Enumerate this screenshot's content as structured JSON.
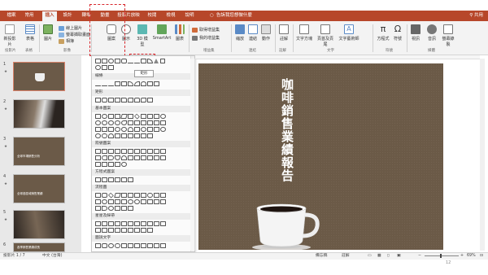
{
  "tabs": [
    {
      "label": "檔案",
      "active": false
    },
    {
      "label": "常用",
      "active": false
    },
    {
      "label": "插入",
      "active": true
    },
    {
      "label": "設計",
      "active": false
    },
    {
      "label": "轉場",
      "active": false
    },
    {
      "label": "動畫",
      "active": false
    },
    {
      "label": "投影片放映",
      "active": false
    },
    {
      "label": "校閱",
      "active": false
    },
    {
      "label": "檢視",
      "active": false
    },
    {
      "label": "說明",
      "active": false
    }
  ],
  "tell_me": "告訴我您想做什麼",
  "share": "共用",
  "ribbon": {
    "new_slide": "新投影片",
    "table": "表格",
    "images": "圖片",
    "online_images": "線上圖片",
    "screenshot": "螢幕擷取畫面",
    "album": "相簿",
    "shapes": "圖案",
    "icons": "圖示",
    "models_3d": "3D 模型",
    "smartart": "SmartArt",
    "chart": "圖表",
    "get_addins": "取得增益集",
    "my_addins": "我的增益集",
    "zoom": "縮放",
    "link": "連結",
    "action": "動作",
    "comment": "註解",
    "textbox": "文字方塊",
    "header_footer": "頁首及頁尾",
    "wordart": "文字藝術師",
    "equation": "方程式",
    "symbol": "符號",
    "video": "視訊",
    "audio": "音訊",
    "screen_recording": "螢幕錄製",
    "groups": {
      "slides": "投影片",
      "tables": "表格",
      "images": "影像",
      "addins": "增益集",
      "links": "連結",
      "comments": "註解",
      "text": "文字",
      "symbols": "符號",
      "media": "媒體"
    }
  },
  "gallery": {
    "sections": [
      "線條",
      "矩形",
      "基本圖案",
      "箭號圖案",
      "方程式圖案",
      "流程圖",
      "星星及綵帶",
      "圖說文字"
    ],
    "tooltip": "矩形"
  },
  "slides": [
    {
      "num": "1",
      "title": "咖啡銷售業績報告",
      "selected": true
    },
    {
      "num": "2",
      "title": "",
      "selected": false
    },
    {
      "num": "3",
      "title": "全球市場銷售分析",
      "selected": false
    },
    {
      "num": "4",
      "title": "全球各區域銷售業績",
      "selected": false
    },
    {
      "num": "5",
      "title": "",
      "selected": false
    },
    {
      "num": "6",
      "title": "各季銷售業績成長",
      "selected": false
    }
  ],
  "main_slide": {
    "title": "咖啡銷售業績報告"
  },
  "status": {
    "slide_counter": "投影片 1 / 7",
    "language": "中文 (台灣)",
    "notes": "備忘稿",
    "comments": "註解",
    "zoom": "69%"
  },
  "page_mark": "12",
  "colors": {
    "accent": "#b7472a",
    "slide_bg": "#6b5a47",
    "highlight": "#d8272d"
  }
}
